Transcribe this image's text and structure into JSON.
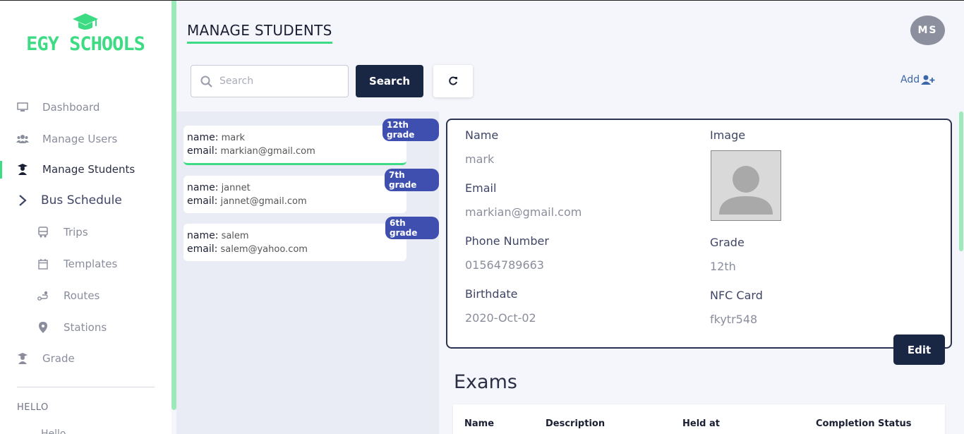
{
  "app": {
    "logo_text": "EGY SCHOOLS",
    "accent": "#3ddc84",
    "primary": "#1a2744"
  },
  "sidebar": {
    "items": [
      {
        "label": "Dashboard",
        "icon": "monitor-icon"
      },
      {
        "label": "Manage Users",
        "icon": "users-icon"
      },
      {
        "label": "Manage Students",
        "icon": "student-icon",
        "active": true
      },
      {
        "label": "Bus Schedule",
        "icon": "chevron-right-icon"
      },
      {
        "label": "Trips",
        "icon": "bus-icon"
      },
      {
        "label": "Templates",
        "icon": "calendar-icon"
      },
      {
        "label": "Routes",
        "icon": "route-icon"
      },
      {
        "label": "Stations",
        "icon": "map-pin-icon"
      },
      {
        "label": "Grade",
        "icon": "graduate-icon"
      }
    ],
    "section_label": "HELLO",
    "cut_item": "Hello"
  },
  "header": {
    "title": "MANAGE STUDENTS",
    "avatar_initials": "MS"
  },
  "toolbar": {
    "search_placeholder": "Search",
    "search_label": "Search",
    "add_label": "Add"
  },
  "students": [
    {
      "name_key": "name:",
      "name": "mark",
      "email_key": "email:",
      "email": "markian@gmail.com",
      "grade": "12th grade"
    },
    {
      "name_key": "name:",
      "name": "jannet",
      "email_key": "email:",
      "email": "jannet@gmail.com",
      "grade": "7th grade"
    },
    {
      "name_key": "name:",
      "name": "salem",
      "email_key": "email:",
      "email": "salem@yahoo.com",
      "grade": "6th grade"
    }
  ],
  "detail": {
    "name_label": "Name",
    "name": "mark",
    "email_label": "Email",
    "email": "markian@gmail.com",
    "phone_label": "Phone Number",
    "phone": "01564789663",
    "birthdate_label": "Birthdate",
    "birthdate": "2020-Oct-02",
    "image_label": "Image",
    "grade_label": "Grade",
    "grade": "12th",
    "nfc_label": "NFC Card",
    "nfc": "fkytr548",
    "edit_label": "Edit"
  },
  "exams": {
    "title": "Exams",
    "columns": [
      "Name",
      "Description",
      "Held at",
      "Completion Status"
    ]
  }
}
